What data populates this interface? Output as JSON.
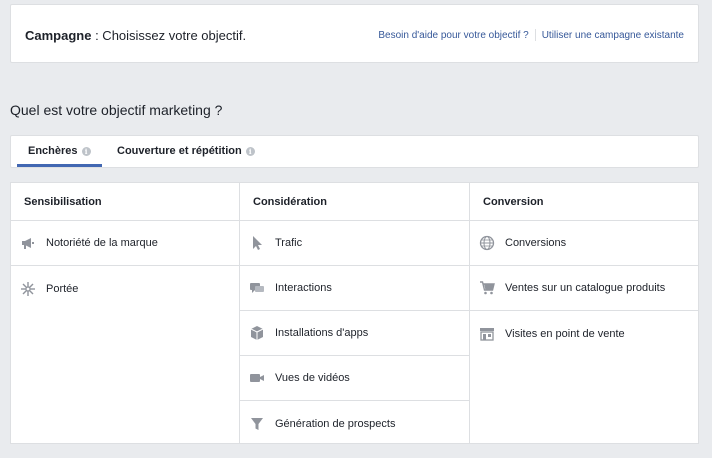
{
  "header": {
    "title_bold": "Campagne",
    "title_rest": " : Choisissez votre objectif.",
    "help_link": "Besoin d'aide pour votre objectif ?",
    "existing_link": "Utiliser une campagne existante"
  },
  "question": "Quel est votre objectif marketing ?",
  "tabs": [
    {
      "label": "Enchères",
      "active": true
    },
    {
      "label": "Couverture et répétition",
      "active": false
    }
  ],
  "columns": [
    {
      "title": "Sensibilisation",
      "items": [
        {
          "label": "Notoriété de la marque",
          "icon": "megaphone-icon"
        },
        {
          "label": "Portée",
          "icon": "reach-snowflake-icon"
        }
      ]
    },
    {
      "title": "Considération",
      "items": [
        {
          "label": "Trafic",
          "icon": "cursor-icon"
        },
        {
          "label": "Interactions",
          "icon": "chat-bubbles-icon"
        },
        {
          "label": "Installations d'apps",
          "icon": "cube-icon"
        },
        {
          "label": "Vues de vidéos",
          "icon": "video-camera-icon"
        },
        {
          "label": "Génération de prospects",
          "icon": "funnel-icon"
        }
      ]
    },
    {
      "title": "Conversion",
      "items": [
        {
          "label": "Conversions",
          "icon": "globe-icon"
        },
        {
          "label": "Ventes sur un catalogue produits",
          "icon": "shopping-cart-icon"
        },
        {
          "label": "Visites en point de vente",
          "icon": "storefront-icon"
        }
      ]
    }
  ],
  "colors": {
    "accent": "#4267b2",
    "link": "#365899",
    "icon": "#90949c",
    "background": "#e9ebee"
  }
}
